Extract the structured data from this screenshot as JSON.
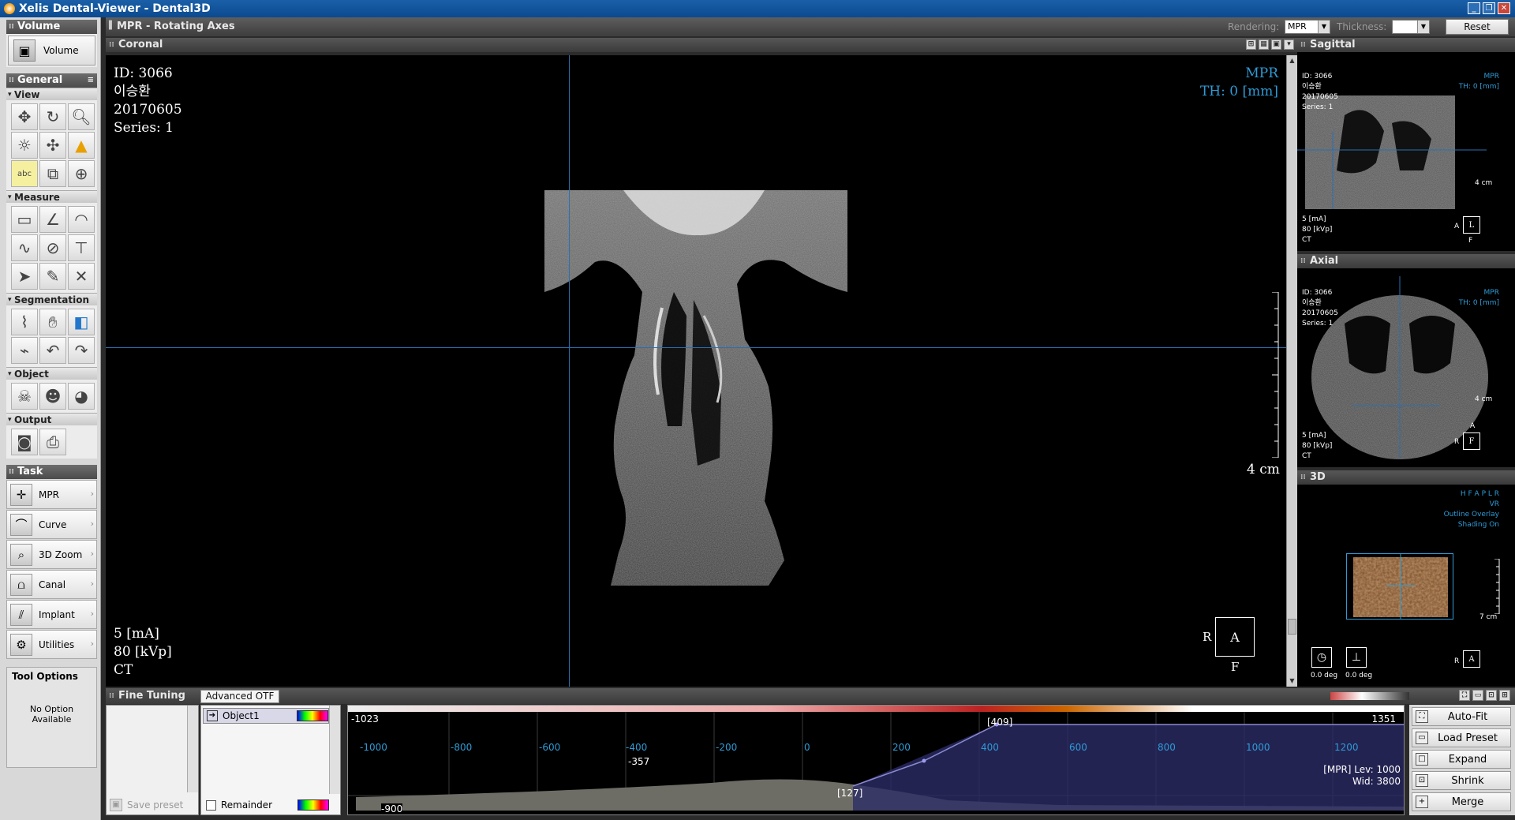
{
  "window": {
    "title": "Xelis Dental-Viewer - Dental3D"
  },
  "left": {
    "volume": {
      "header": "Volume",
      "button": "Volume"
    },
    "general": {
      "header": "General",
      "view_label": "View",
      "measure_label": "Measure",
      "segmentation_label": "Segmentation",
      "object_label": "Object",
      "output_label": "Output"
    },
    "task": {
      "header": "Task",
      "items": [
        "MPR",
        "Curve",
        "3D Zoom",
        "Canal",
        "Implant",
        "Utilities"
      ]
    },
    "tool_options": {
      "title": "Tool Options",
      "message": "No Option Available"
    }
  },
  "toolbar": {
    "title": "MPR - Rotating Axes",
    "rendering_label": "Rendering:",
    "rendering_value": "MPR",
    "thickness_label": "Thickness:",
    "thickness_value": "",
    "reset_label": "Reset"
  },
  "coronal": {
    "header": "Coronal",
    "id": "ID: 3066",
    "name": "이승환",
    "date": "20170605",
    "series": "Series: 1",
    "mode": "MPR",
    "thickness": "TH: 0 [mm]",
    "ma": "5 [mA]",
    "kvp": "80 [kVp]",
    "modality": "CT",
    "scale": "4 cm",
    "orient_left": "R",
    "orient_center": "A",
    "orient_bottom": "F"
  },
  "sagittal": {
    "header": "Sagittal",
    "id": "ID: 3066",
    "name": "이승환",
    "date": "20170605",
    "series": "Series: 1",
    "mode": "MPR",
    "thickness": "TH: 0 [mm]",
    "ma": "5 [mA]",
    "kvp": "80 [kVp]",
    "modality": "CT",
    "scale": "4 cm",
    "orient_left": "A",
    "orient_center": "L",
    "orient_bottom": "F"
  },
  "axial": {
    "header": "Axial",
    "id": "ID: 3066",
    "name": "이승환",
    "date": "20170605",
    "series": "Series: 1",
    "mode": "MPR",
    "thickness": "TH: 0 [mm]",
    "ma": "5 [mA]",
    "kvp": "80 [kVp]",
    "modality": "CT",
    "scale": "4 cm",
    "orient_top": "A",
    "orient_left": "R",
    "orient_center": "F"
  },
  "view3d": {
    "header": "3D",
    "orient_letters": "H F A P L R",
    "mode": "VR",
    "outline": "Outline Overlay",
    "shading": "Shading On",
    "scale": "7 cm",
    "rot1": "0.0 deg",
    "rot2": "0.0 deg",
    "orient_left": "R",
    "orient_center": "A"
  },
  "fine_tuning": {
    "header": "Fine Tuning",
    "tab": "Advanced OTF",
    "object_name": "Object1",
    "remainder": "Remainder",
    "save_preset": "Save preset",
    "min": "-1023",
    "max": "1351",
    "marker_top": "[409]",
    "marker_bottom": "[127]",
    "left_mark": "-357",
    "cursor_value": "-900",
    "ticks": [
      "-1000",
      "-800",
      "-600",
      "-400",
      "-200",
      "0",
      "200",
      "400",
      "600",
      "800",
      "1000",
      "1200"
    ],
    "level": "[MPR] Lev:  1000",
    "width": "Wid:  3800",
    "buttons": [
      "Auto-Fit",
      "Load Preset",
      "Expand",
      "Shrink",
      "Merge"
    ]
  },
  "colors": {
    "accent": "#2e9bd6",
    "crosshair": "#2a6fb0",
    "header": "#4b4b4b"
  }
}
